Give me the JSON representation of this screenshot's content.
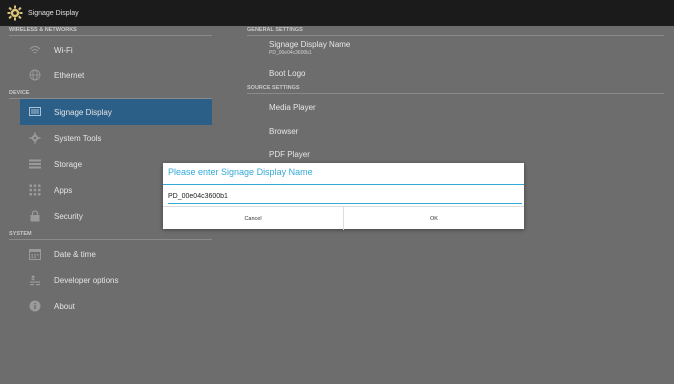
{
  "titlebar": {
    "title": "Signage Display",
    "icon": "gear-icon"
  },
  "sidebar": {
    "sections": {
      "wireless": "WIRELESS & NETWORKS",
      "device": "DEVICE",
      "system": "SYSTEM"
    },
    "items": [
      {
        "label": "Wi-Fi",
        "icon": "wifi-icon"
      },
      {
        "label": "Ethernet",
        "icon": "globe-icon"
      },
      {
        "label": "Signage Display",
        "icon": "display-icon",
        "selected": true
      },
      {
        "label": "System Tools",
        "icon": "gear-icon"
      },
      {
        "label": "Storage",
        "icon": "storage-icon"
      },
      {
        "label": "Apps",
        "icon": "apps-icon"
      },
      {
        "label": "Security",
        "icon": "lock-icon"
      },
      {
        "label": "Date & time",
        "icon": "calendar-icon"
      },
      {
        "label": "Developer options",
        "icon": "developer-icon"
      },
      {
        "label": "About",
        "icon": "info-icon"
      }
    ]
  },
  "content": {
    "sections": {
      "general": "GENERAL SETTINGS",
      "source": "SOURCE SETTINGS"
    },
    "items": {
      "signage_name": {
        "label": "Signage Display Name",
        "sub": "PD_00e04c3600b1"
      },
      "boot_logo": {
        "label": "Boot Logo"
      },
      "media_player": {
        "label": "Media Player"
      },
      "browser": {
        "label": "Browser"
      },
      "pdf_player": {
        "label": "PDF Player"
      }
    }
  },
  "dialog": {
    "title": "Please enter Signage Display Name",
    "input_value": "PD_00e04c3600b1",
    "cancel_label": "Cancel",
    "ok_label": "OK",
    "accent": "#33a9d6"
  },
  "colors": {
    "background": "#6d6d6d",
    "titlebar": "#1b1b1b",
    "selected": "#2c5f88"
  }
}
